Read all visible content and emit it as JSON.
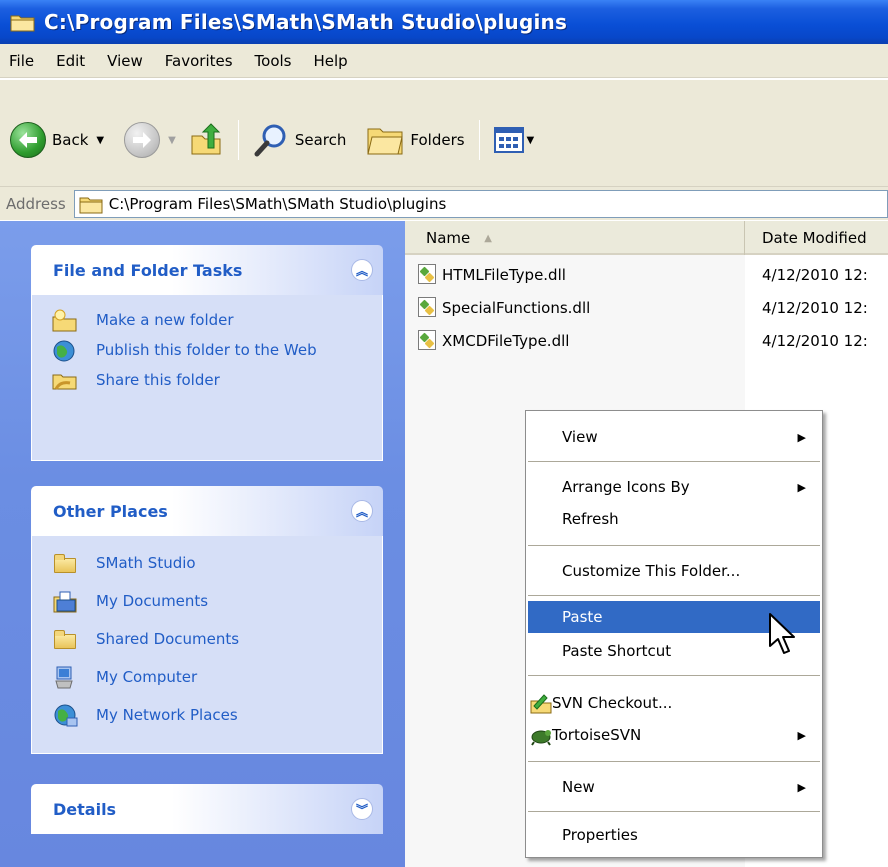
{
  "window": {
    "title": "C:\\Program Files\\SMath\\SMath Studio\\plugins"
  },
  "menu": [
    "File",
    "Edit",
    "View",
    "Favorites",
    "Tools",
    "Help"
  ],
  "toolbar": {
    "back": "Back",
    "search": "Search",
    "folders": "Folders"
  },
  "address": {
    "label": "Address",
    "value": "C:\\Program Files\\SMath\\SMath Studio\\plugins"
  },
  "tasks_panel": {
    "title": "File and Folder Tasks",
    "items": [
      "Make a new folder",
      "Publish this folder to the Web",
      "Share this folder"
    ]
  },
  "places_panel": {
    "title": "Other Places",
    "items": [
      "SMath Studio",
      "My Documents",
      "Shared Documents",
      "My Computer",
      "My Network Places"
    ]
  },
  "details_panel": {
    "title": "Details"
  },
  "columns": {
    "name": "Name",
    "date": "Date Modified"
  },
  "files": [
    {
      "name": "HTMLFileType.dll",
      "date": "4/12/2010 12:"
    },
    {
      "name": "SpecialFunctions.dll",
      "date": "4/12/2010 12:"
    },
    {
      "name": "XMCDFileType.dll",
      "date": "4/12/2010 12:"
    }
  ],
  "context_menu": {
    "view": "View",
    "arrange": "Arrange Icons By",
    "refresh": "Refresh",
    "customize": "Customize This Folder...",
    "paste": "Paste",
    "paste_shortcut": "Paste Shortcut",
    "svn_checkout": "SVN Checkout...",
    "tortoise": "TortoiseSVN",
    "new": "New",
    "properties": "Properties"
  },
  "colors": {
    "title_bar": "#0a4fd6",
    "task_pane": "#6b8ee3",
    "panel_title": "#215dc6",
    "menu_highlight": "#316ac5"
  }
}
